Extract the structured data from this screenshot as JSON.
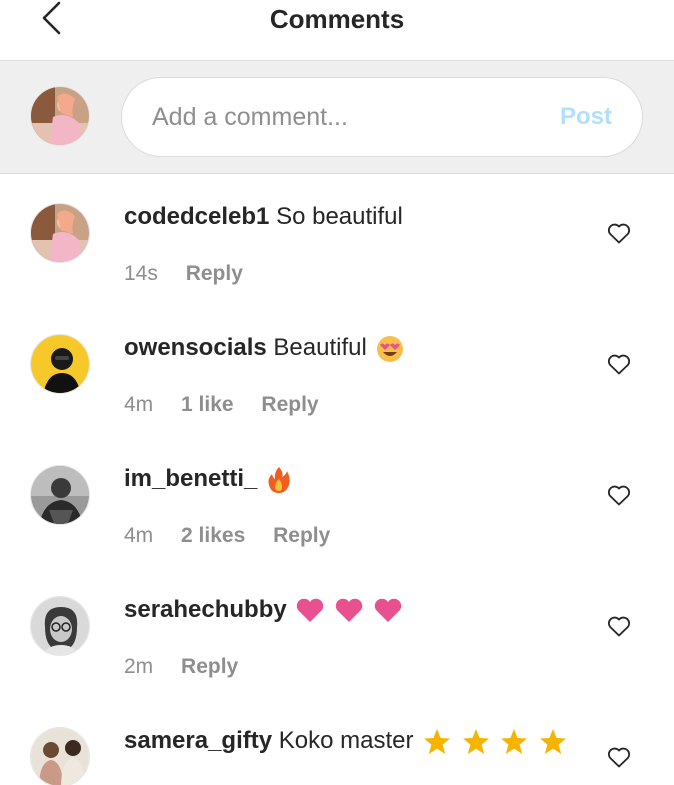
{
  "header": {
    "title": "Comments"
  },
  "composer": {
    "placeholder": "Add a comment...",
    "post_label": "Post"
  },
  "comments": [
    {
      "username": "codedceleb1",
      "text": "So beautiful",
      "time": "14s",
      "likes": "",
      "reply": "Reply"
    },
    {
      "username": "owensocials",
      "text": "Beautiful",
      "time": "4m",
      "likes": "1 like",
      "reply": "Reply"
    },
    {
      "username": "im_benetti_",
      "text": "",
      "time": "4m",
      "likes": "2 likes",
      "reply": "Reply"
    },
    {
      "username": "serahechubby",
      "text": "",
      "time": "2m",
      "likes": "",
      "reply": "Reply"
    },
    {
      "username": "samera_gifty",
      "text": "Koko master",
      "time": "",
      "likes": "",
      "reply": ""
    }
  ],
  "icons": {
    "back": "chevron-left-icon",
    "like": "heart-outline-icon",
    "emoji_heart_eyes": "heart-eyes-emoji",
    "emoji_fire": "fire-emoji",
    "emoji_heart": "pink-heart-emoji",
    "emoji_star": "star-emoji"
  },
  "colors": {
    "post_disabled": "#b2dffc",
    "secondary_text": "#8e8e8e",
    "heart_emoji": "#e8508f",
    "star_emoji": "#f4b400"
  }
}
